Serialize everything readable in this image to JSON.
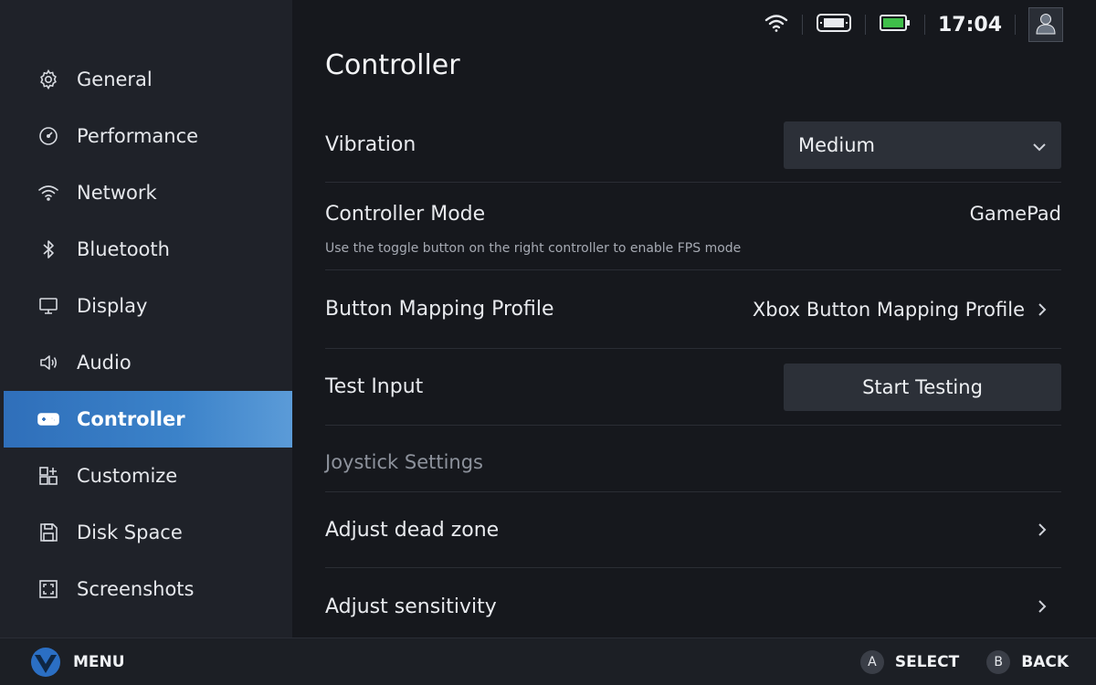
{
  "status": {
    "wifi_icon": "wifi-icon",
    "device_icon": "handheld-icon",
    "battery_icon": "battery-icon",
    "clock": "17:04",
    "avatar_icon": "user-icon"
  },
  "sidebar": {
    "items": [
      {
        "label": "General",
        "icon": "gear-icon"
      },
      {
        "label": "Performance",
        "icon": "gauge-icon"
      },
      {
        "label": "Network",
        "icon": "wifi-icon"
      },
      {
        "label": "Bluetooth",
        "icon": "bluetooth-icon"
      },
      {
        "label": "Display",
        "icon": "monitor-icon"
      },
      {
        "label": "Audio",
        "icon": "speaker-icon"
      },
      {
        "label": "Controller",
        "icon": "gamepad-icon",
        "active": true
      },
      {
        "label": "Customize",
        "icon": "grid-plus-icon"
      },
      {
        "label": "Disk Space",
        "icon": "disk-icon"
      },
      {
        "label": "Screenshots",
        "icon": "screenshot-icon"
      }
    ]
  },
  "main": {
    "title": "Controller",
    "vibration": {
      "label": "Vibration",
      "value": "Medium"
    },
    "controller_mode": {
      "label": "Controller Mode",
      "value": "GamePad",
      "description": "Use the toggle button on the right controller to enable FPS mode"
    },
    "button_mapping": {
      "label": "Button Mapping Profile",
      "value": "Xbox Button Mapping Profile"
    },
    "test_input": {
      "label": "Test Input",
      "button": "Start Testing"
    },
    "joystick_section": "Joystick Settings",
    "dead_zone": {
      "label": "Adjust dead zone"
    },
    "sensitivity": {
      "label": "Adjust sensitivity"
    }
  },
  "bottom": {
    "menu_label": "MENU",
    "select_key": "A",
    "select_label": "SELECT",
    "back_key": "B",
    "back_label": "BACK"
  },
  "colors": {
    "background": "#16181d",
    "sidebar": "#1f2229",
    "accent": "#3b82c9"
  }
}
